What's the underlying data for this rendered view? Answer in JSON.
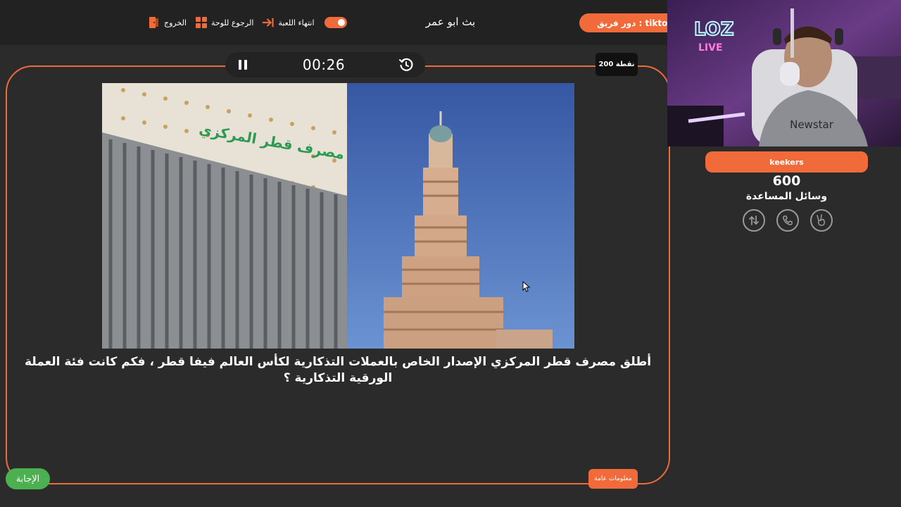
{
  "topbar": {
    "exit_label": "الخروج",
    "board_label": "الرجوع للوحة",
    "end_game_label": "انتهاء اللعبة",
    "title": "بث ابو عمر",
    "team_turn": "دور فريق : tiktokirz"
  },
  "timer": {
    "time": "00:26"
  },
  "points_badge": "200 نقطة",
  "question": {
    "text": "أطلق مصرف قطر المركزي الإصدار الخاص بالعملات التذكارية لكأس العالم فيفا قطر ، فكم كانت فئة العملة الورقية التذكارية ؟",
    "image_sign": "مصرف قطر المركزي"
  },
  "category_badge": "معلومات عامة",
  "answer_button": "الإجابة",
  "team_panel": {
    "team_name": "keekers",
    "score": "600",
    "help_title": "وسائل المساعدة"
  },
  "webcam": {
    "neon_sign": "LOZ",
    "neon_sub": "LIVE",
    "shirt_text": "Newstar"
  },
  "colors": {
    "accent": "#f06a3a",
    "answer": "#4caf50",
    "background": "#2b2b2b",
    "topbar": "#222222"
  },
  "icons": {
    "exit": "exit-door-icon",
    "board": "grid-board-icon",
    "end_game": "arrow-to-line-icon",
    "toggle": "toggle-switch-icon",
    "pause": "pause-icon",
    "reset": "restart-timer-icon",
    "help": [
      "swap-arrows-icon",
      "phone-icon",
      "victory-hand-icon"
    ]
  }
}
